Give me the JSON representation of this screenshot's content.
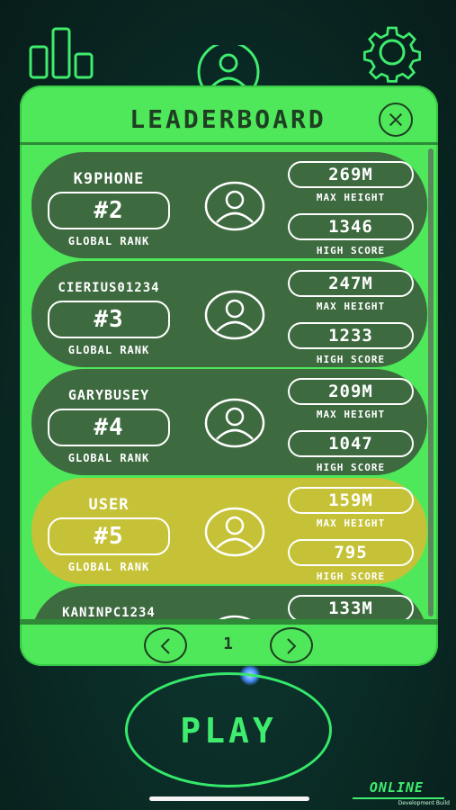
{
  "header": {
    "title": "LEADERBOARD"
  },
  "rank_label": "GLOBAL RANK",
  "max_height_label": "MAX HEIGHT",
  "high_score_label": "HIGH SCORE",
  "entries": [
    {
      "name": "K9PHONE",
      "rank": "#2",
      "max_height": "269M",
      "high_score": "1346",
      "is_user": false
    },
    {
      "name": "CIERIUS01234",
      "rank": "#3",
      "max_height": "247M",
      "high_score": "1233",
      "is_user": false
    },
    {
      "name": "GARYBUSEY",
      "rank": "#4",
      "max_height": "209M",
      "high_score": "1047",
      "is_user": false
    },
    {
      "name": "USER",
      "rank": "#5",
      "max_height": "159M",
      "high_score": "795",
      "is_user": true
    },
    {
      "name": "KANINPC1234",
      "rank": "",
      "max_height": "133M",
      "high_score": "",
      "is_user": false
    }
  ],
  "pagination": {
    "page": "1"
  },
  "play_label": "PLAY",
  "status": {
    "online": "ONLINE",
    "build": "Development Build"
  },
  "colors": {
    "panel": "#4ee85a",
    "row": "#3d6a3f",
    "user_row": "#c6c238",
    "accent": "#3fec6e"
  },
  "icons": [
    "stats-icon",
    "profile-icon",
    "gear-icon",
    "close-icon",
    "avatar-icon",
    "chevron-left-icon",
    "chevron-right-icon"
  ]
}
